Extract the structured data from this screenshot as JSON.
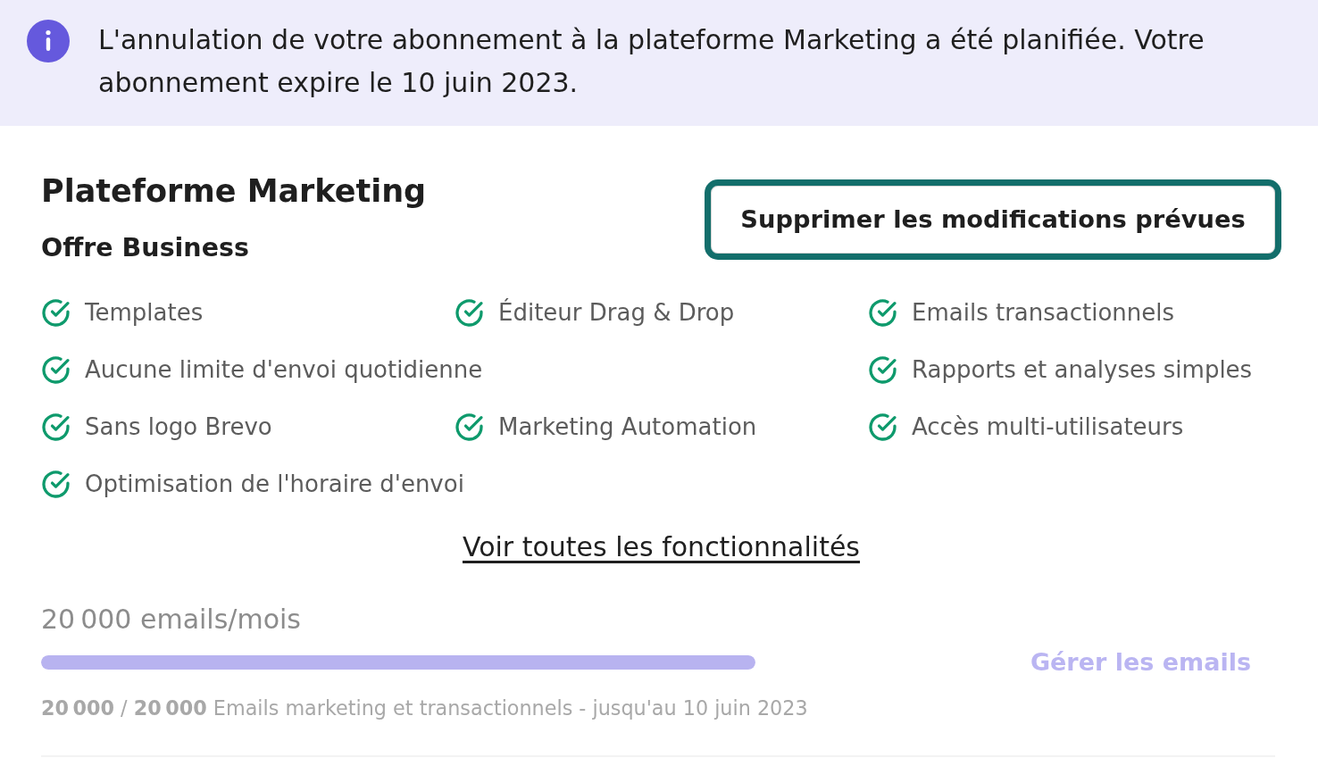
{
  "banner": {
    "text": "L'annulation de votre abonnement à la plateforme Marketing a été planifiée. Votre abonnement expire le 10 juin 2023."
  },
  "product": {
    "title": "Plateforme Marketing",
    "plan": "Offre Business"
  },
  "action_button": {
    "label": "Supprimer les modifications prévues",
    "focused": true
  },
  "features": [
    {
      "label": "Templates",
      "wide": false
    },
    {
      "label": "Éditeur Drag & Drop",
      "wide": false
    },
    {
      "label": "Emails transactionnels",
      "wide": false
    },
    {
      "label": "Aucune limite d'envoi quotidienne",
      "wide": true
    },
    {
      "label": "Rapports et analyses simples",
      "wide": false
    },
    {
      "label": "Sans logo Brevo",
      "wide": false
    },
    {
      "label": "Marketing Automation",
      "wide": false
    },
    {
      "label": "Accès multi-utilisateurs",
      "wide": false
    },
    {
      "label": "Optimisation de l'horaire d'envoi",
      "wide": false
    }
  ],
  "all_features_link": "Voir toutes les fonctionnalités",
  "usage": {
    "title": "20 000 emails/mois",
    "level": 1,
    "manage_link": {
      "label": "Gérer les emails",
      "disabled": true
    },
    "detail": "**20 000** / **20 000** Emails marketing et transactionnels - jusqu'au 10 juin 2023"
  }
}
